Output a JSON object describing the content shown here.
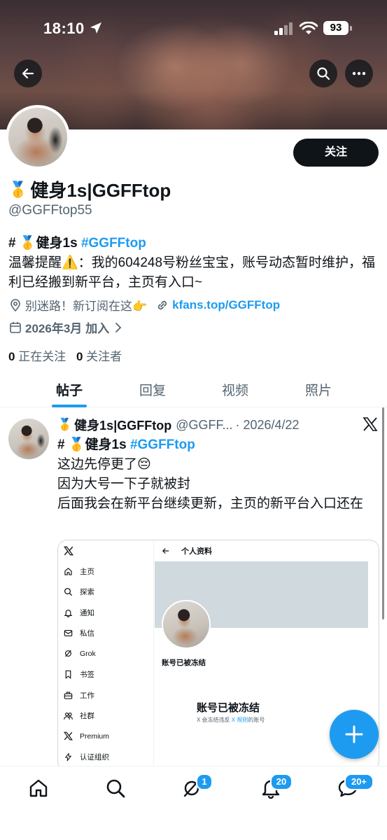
{
  "status_bar": {
    "time": "18:10",
    "battery": "93"
  },
  "profile": {
    "name_emoji": "🥇",
    "display_name": "健身1s|GGFFtop",
    "handle": "@GGFFtop55",
    "follow_label": "关注",
    "bio_line1_prefix": "# ",
    "bio_line1_emoji": "🥇",
    "bio_line1_text": "健身1s ",
    "bio_line1_hashtag": "#GGFFtop",
    "bio_line2": "温馨提醒⚠️：我的604248号粉丝宝宝，账号动态暂时维护，福利已经搬到新平台，主页有入口~",
    "location": "别迷路！新订阅在这👉",
    "website": "kfans.top/GGFFtop",
    "joined_date": "2026年3月",
    "joined_suffix": "加入",
    "following_count": "0",
    "following_label": "正在关注",
    "followers_count": "0",
    "followers_label": "关注者"
  },
  "tabs": [
    {
      "label": "帖子",
      "active": true
    },
    {
      "label": "回复",
      "active": false
    },
    {
      "label": "视频",
      "active": false
    },
    {
      "label": "照片",
      "active": false
    }
  ],
  "tweet": {
    "name_emoji": "🥇",
    "name": "健身1s|GGFFtop",
    "handle": "@GGFF...",
    "date": "· 2026/4/22",
    "line1_prefix": "# ",
    "line1_emoji": "🥇",
    "line1_text": "健身1s ",
    "line1_hashtag": "#GGFFtop",
    "line2": "这边先停更了😔",
    "line3": "因为大号一下子就被封",
    "line4": "后面我会在新平台继续更新，主页的新平台入口还在"
  },
  "embedded_screenshot": {
    "menu": [
      "主页",
      "探索",
      "通知",
      "私信",
      "Grok",
      "书签",
      "工作",
      "社群",
      "Premium",
      "认证组织"
    ],
    "header_title": "个人资料",
    "frozen_label": "账号已被冻结",
    "frozen_title": "账号已被冻结",
    "frozen_desc_a": "X 会冻结违反 ",
    "frozen_desc_link": "X 规则",
    "frozen_desc_b": "的账号"
  },
  "bottom_nav": {
    "grok_badge": "1",
    "notifications_badge": "20",
    "messages_badge": "20+"
  },
  "colors": {
    "accent": "#1d9bf0",
    "text": "#0f1419",
    "secondary": "#536471"
  }
}
